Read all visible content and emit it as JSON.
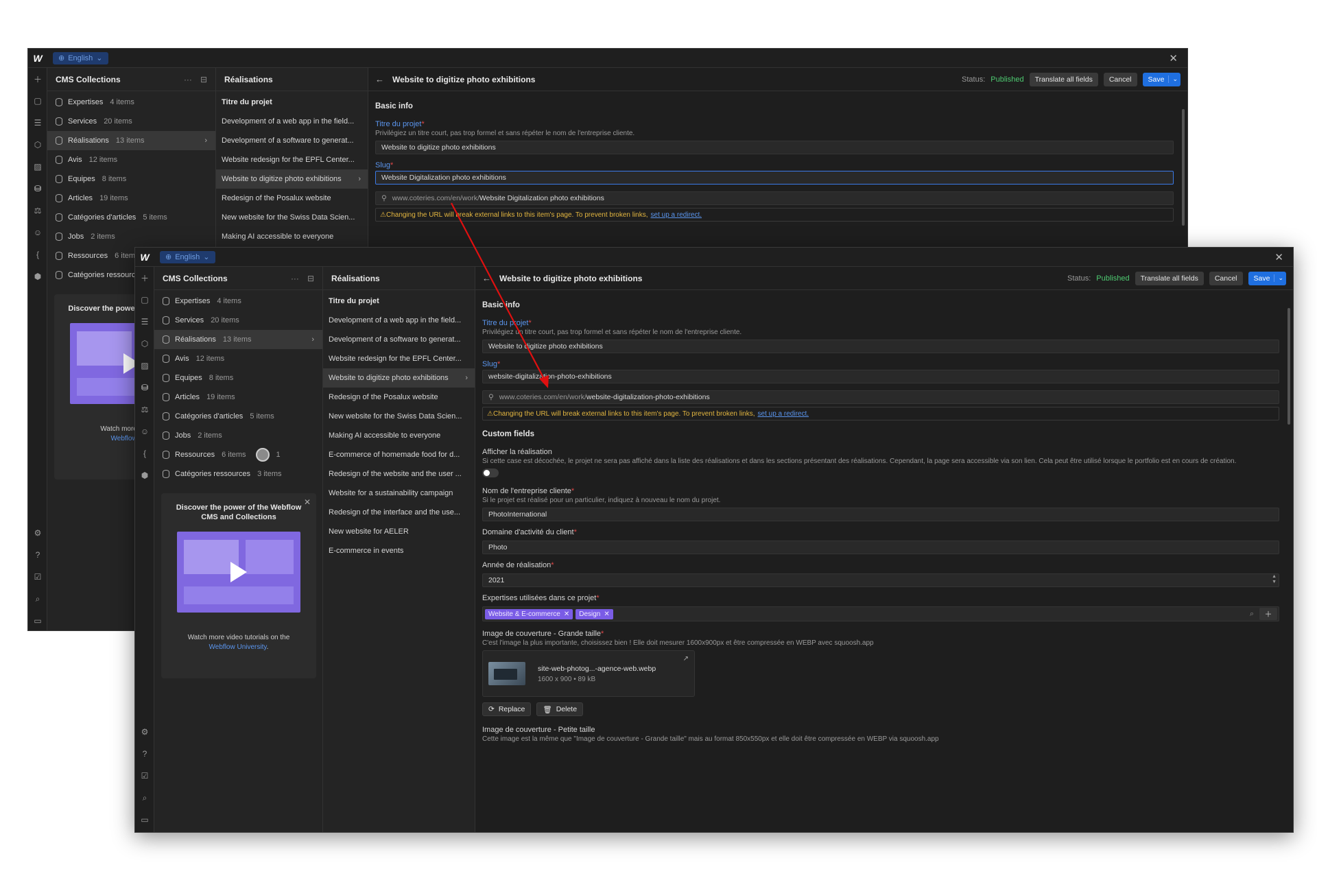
{
  "app": {
    "language": "English",
    "logo": "W"
  },
  "collections": {
    "title": "CMS Collections",
    "items": [
      {
        "name": "Expertises",
        "count": "4 items"
      },
      {
        "name": "Services",
        "count": "20 items"
      },
      {
        "name": "Réalisations",
        "count": "13 items"
      },
      {
        "name": "Avis",
        "count": "12 items"
      },
      {
        "name": "Equipes",
        "count": "8 items"
      },
      {
        "name": "Articles",
        "count": "19 items"
      },
      {
        "name": "Catégories d'articles",
        "count": "5 items"
      },
      {
        "name": "Jobs",
        "count": "2 items"
      },
      {
        "name": "Ressources",
        "count": "6 items"
      },
      {
        "name": "Catégories ressources",
        "count": "3 items"
      }
    ],
    "back_truncated": {
      "ressources_count": "6 item",
      "cat_ressources": "Catégories ressourc"
    },
    "presence_count": "1",
    "promo": {
      "title": "Discover the power of the Webflow CMS and Collections",
      "back_title": "Discover the power o CMS and Coll",
      "desc": "Watch more video tutorials on the",
      "link": "Webflow University",
      "period": ".",
      "back_desc": "Watch more video tu",
      "back_link": "Webflow Univ"
    }
  },
  "items_pane": {
    "title": "Réalisations",
    "column": "Titre du projet",
    "rows": [
      "Development of a web app in the field...",
      "Development of a software to generat...",
      "Website redesign for the EPFL Center...",
      "Website to digitize photo exhibitions",
      "Redesign of the Posalux website",
      "New website for the Swiss Data Scien...",
      "Making AI accessible to everyone",
      "E-commerce of homemade food for d...",
      "Redesign of the website and the user ...",
      "Website for a sustainability campaign",
      "Redesign of the interface and the use...",
      "New website for AELER",
      "E-commerce in events"
    ]
  },
  "editor": {
    "title": "Website to digitize photo exhibitions",
    "status_label": "Status:",
    "status_value": "Published",
    "translate": "Translate all fields",
    "cancel": "Cancel",
    "save": "Save",
    "basic_info": "Basic info",
    "titre_label": "Titre du projet",
    "titre_help": "Privilégiez un titre court, pas trop formel et sans répéter le nom de l'entreprise cliente.",
    "titre_value": "Website to digitize photo exhibitions",
    "slug_label": "Slug",
    "slug_value_back": "Website Digitalization photo exhibitions",
    "slug_value": "website-digitalization-photo-exhibitions",
    "url_prefix": "www.coteries.com/en/work/",
    "url_slug_back": "Website Digitalization photo exhibitions",
    "url_slug": "website-digitalization-photo-exhibitions",
    "warning": "Changing the URL will break external links to this item's page. To prevent broken links,",
    "warning_link": "set up a redirect.",
    "custom_fields": "Custom fields",
    "afficher_label": "Afficher la réalisation",
    "afficher_help": "Si cette case est décochée, le projet ne sera pas affiché dans la liste des réalisations et dans les sections présentant des réalisations. Cependant, la page sera accessible via son lien. Cela peut être utilisé lorsque le portfolio est en cours de création.",
    "entreprise_label": "Nom de l'entreprise cliente",
    "entreprise_help": "Si le projet est réalisé pour un particulier, indiquez à nouveau le nom du projet.",
    "entreprise_value": "PhotoInternational",
    "domaine_label": "Domaine d'activité du client",
    "domaine_value": "Photo",
    "annee_label": "Année de réalisation",
    "annee_value": "2021",
    "expertises_label": "Expertises utilisées dans ce projet",
    "tags": [
      "Website & E-commerce",
      "Design"
    ],
    "cover_label": "Image de couverture - Grande taille",
    "cover_help": "C'est l'image la plus importante, choisissez bien ! Elle doit mesurer 1600x900px et être compressée en WEBP avec squoosh.app",
    "cover_name": "site-web-photog...-agence-web.webp",
    "cover_size": "1600 x 900 • 89 kB",
    "replace": "Replace",
    "delete": "Delete",
    "cover_small_label": "Image de couverture - Petite taille",
    "cover_small_help": "Cette image est la même que \"Image de couverture - Grande taille\" mais au format 850x550px et elle doit être compressée en WEBP via squoosh.app"
  },
  "colors": {
    "accent": "#1f6fe0",
    "published": "#4ecb71",
    "tag": "#7a5ce6",
    "warning": "#e3b640",
    "arrow": "#e01010"
  }
}
